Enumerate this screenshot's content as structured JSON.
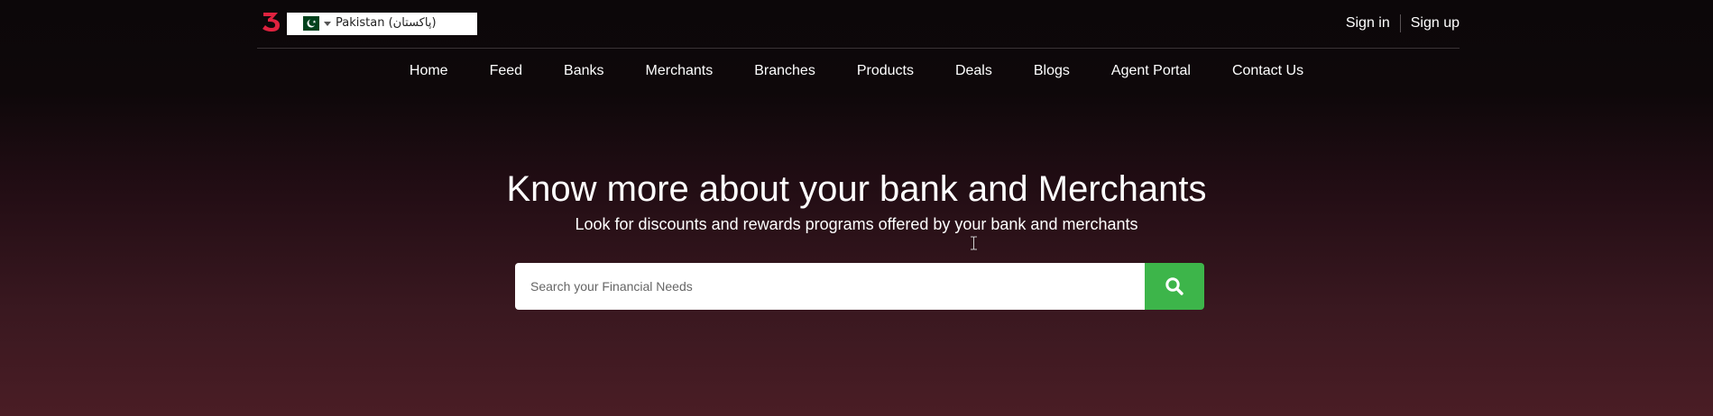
{
  "brand": {
    "logo_icon": "brand-logo-icon",
    "accent": "#e0223f"
  },
  "country_select": {
    "flag_icon": "pakistan-flag-icon",
    "selected": "Pakistan (پاکستان)"
  },
  "auth": {
    "sign_in": "Sign in",
    "sign_up": "Sign up"
  },
  "nav": {
    "items": [
      {
        "label": "Home"
      },
      {
        "label": "Feed"
      },
      {
        "label": "Banks"
      },
      {
        "label": "Merchants"
      },
      {
        "label": "Branches"
      },
      {
        "label": "Products"
      },
      {
        "label": "Deals"
      },
      {
        "label": "Blogs"
      },
      {
        "label": "Agent Portal"
      },
      {
        "label": "Contact Us"
      }
    ]
  },
  "hero": {
    "title": "Know more about your bank and Merchants",
    "subtitle": "Look for discounts and rewards programs offered by your bank and merchants"
  },
  "search": {
    "placeholder": "Search your Financial Needs",
    "value": "",
    "button_icon": "search-icon",
    "button_color": "#3db54a"
  }
}
